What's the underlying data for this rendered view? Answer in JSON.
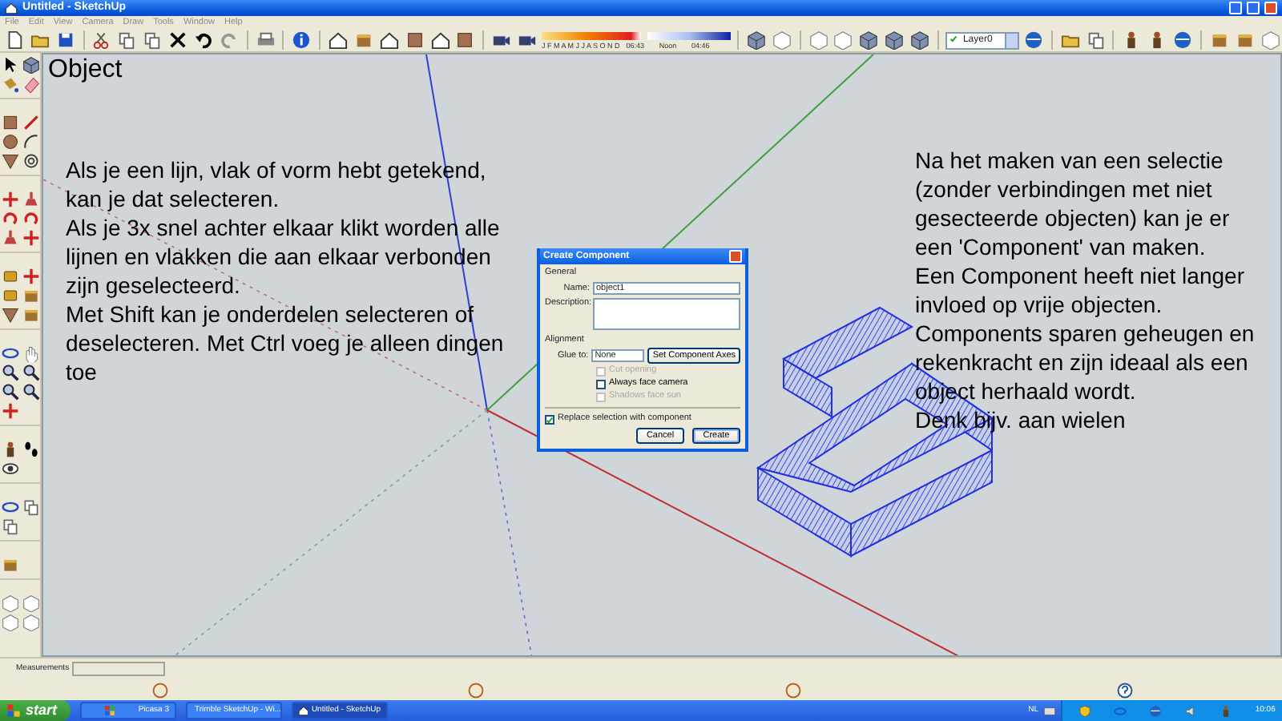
{
  "window": {
    "title": "Untitled - SketchUp"
  },
  "menu": [
    "File",
    "Edit",
    "View",
    "Camera",
    "Draw",
    "Tools",
    "Window",
    "Help"
  ],
  "shadow_toolbar": {
    "months": "J F M A M J J A S O N D",
    "time_start": "06:43",
    "time_mid": "Noon",
    "time_end": "04:46"
  },
  "layer_select": {
    "current": true,
    "name": "Layer0"
  },
  "canvas": {
    "heading": "Object",
    "left_notes": [
      "Als je een lijn, vlak of vorm hebt getekend, kan je dat selecteren.",
      "Als je 3x snel achter elkaar klikt worden alle lijnen en vlakken die aan elkaar verbonden zijn geselecteerd.",
      "Met Shift kan je onderdelen selecteren of deselecteren. Met Ctrl voeg je alleen dingen toe"
    ],
    "right_notes": [
      "Na het maken van een selectie (zonder verbindingen met niet gesecteerde objecten) kan je er een 'Component' van maken.",
      "Een Component heeft niet langer invloed op vrije objecten.",
      "Components sparen geheugen en rekenkracht en zijn ideaal als een object herhaald wordt.",
      "Denk bijv. aan wielen"
    ]
  },
  "dialog": {
    "title": "Create Component",
    "general_label": "General",
    "name_label": "Name:",
    "name_value": "object1",
    "description_label": "Description:",
    "alignment_label": "Alignment",
    "glue_label": "Glue to:",
    "glue_value": "None",
    "axes_button": "Set Component Axes",
    "options": [
      {
        "label": "Cut opening",
        "checked": false,
        "disabled": true
      },
      {
        "label": "Always face camera",
        "checked": false,
        "disabled": false
      },
      {
        "label": "Shadows face sun",
        "checked": false,
        "disabled": true
      }
    ],
    "replace": {
      "label": "Replace selection with component",
      "checked": true
    },
    "buttons": [
      {
        "label": "Cancel",
        "default": false
      },
      {
        "label": "Create",
        "default": true
      }
    ]
  },
  "status_bar": {
    "measurements_label": "Measurements"
  },
  "taskbar": {
    "start": "start",
    "tasks": [
      {
        "label": "Picasa 3",
        "selected": false
      },
      {
        "label": "Trimble SketchUp - Wi...",
        "selected": false
      },
      {
        "label": "Untitled - SketchUp",
        "selected": true
      }
    ],
    "language": "NL",
    "clock": "10:06"
  }
}
